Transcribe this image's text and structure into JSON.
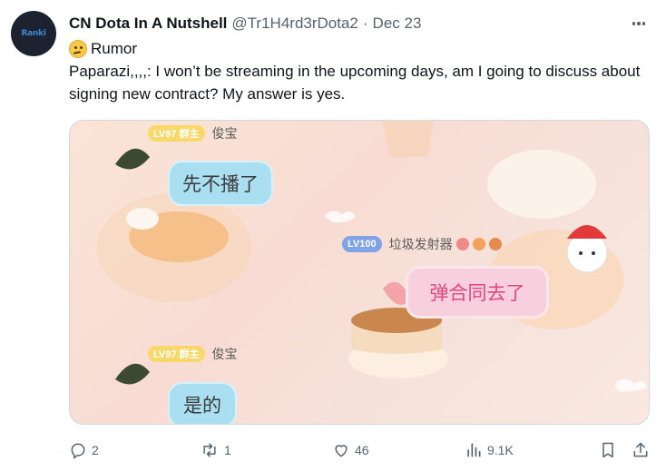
{
  "tweet": {
    "author_name": "CN Dota In A Nutshell",
    "handle": "@Tr1H4rd3rDota2",
    "separator": "·",
    "date": "Dec 23",
    "avatar_text": "Ranki",
    "rumor_label": "Rumor",
    "body": "Paparazi,,,,: I won’t be streaming in the upcoming days, am I going to discuss about signing new contract? My answer is yes."
  },
  "media": {
    "top_user": {
      "badge": "LV97 群主",
      "name": "俊宝"
    },
    "top_message": "先不播了",
    "mid_user": {
      "badge": "LV100",
      "name": "垃圾发射器"
    },
    "mid_message": "弹合同去了",
    "bottom_user": {
      "badge": "LV97 群主",
      "name": "俊宝"
    },
    "bottom_message": "是的"
  },
  "actions": {
    "reply_count": "2",
    "retweet_count": "1",
    "like_count": "46",
    "views_count": "9.1K"
  },
  "icons": {
    "reply": "reply-icon",
    "retweet": "retweet-icon",
    "like": "heart-icon",
    "views": "views-icon",
    "bookmark": "bookmark-icon",
    "share": "share-icon",
    "more": "more-icon"
  },
  "colors": {
    "text": "#0f1419",
    "muted": "#536471",
    "border": "#cfd9de",
    "bubble_blue": "#a9dff0",
    "bubble_pink": "#f8d0dd",
    "accent_pink": "#e0467e"
  }
}
